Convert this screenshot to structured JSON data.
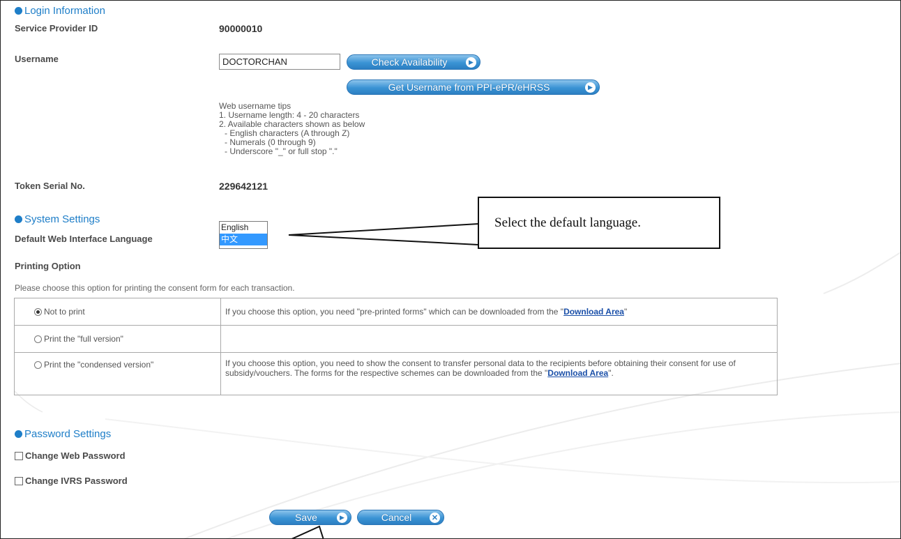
{
  "login": {
    "section_title": "Login Information",
    "sp_id_label": "Service Provider ID",
    "sp_id_value": "90000010",
    "username_label": "Username",
    "username_value": "DOCTORCHAN",
    "check_button": "Check Availability",
    "get_username_button": "Get Username from PPI-ePR/eHRSS",
    "tips": [
      "Web username tips",
      "1. Username length: 4 - 20 characters",
      "2. Available characters shown as below",
      "- English characters (A through Z)",
      "- Numerals (0 through 9)",
      "- Underscore \"_\" or full stop \".\""
    ],
    "token_label": "Token Serial No.",
    "token_value": "229642121"
  },
  "system": {
    "section_title": "System Settings",
    "language_label": "Default Web Interface Language",
    "language_options": [
      "English",
      "中文"
    ],
    "language_selected": "中文",
    "printing_label": "Printing Option",
    "printing_note": "Please choose this option for printing the consent form for each transaction.",
    "options": [
      {
        "label": "Not to print",
        "selected": true,
        "desc": "If you choose this option, you need \"pre-printed forms\" which can be downloaded from the \"",
        "link": "Download Area",
        "desc_end": "\""
      },
      {
        "label": "Print the \"full version\"",
        "selected": false,
        "desc": ""
      },
      {
        "label": "Print the \"condensed version\"",
        "selected": false,
        "desc": "If you choose this option, you need to show the consent to transfer personal data to the recipients before obtaining their consent for use of subsidy/vouchers. The forms for the respective schemes can be downloaded from the \"",
        "link": "Download Area",
        "desc_end": "\"."
      }
    ]
  },
  "password": {
    "section_title": "Password Settings",
    "change_web": "Change Web Password",
    "change_ivrs": "Change IVRS Password"
  },
  "actions": {
    "save": "Save",
    "cancel": "Cancel"
  },
  "callout": {
    "text": "Select the default language."
  },
  "colors": {
    "accent": "#1e7ec8",
    "button": "#3a93d4",
    "link": "#1a4fa8",
    "selection": "#3399ff"
  }
}
